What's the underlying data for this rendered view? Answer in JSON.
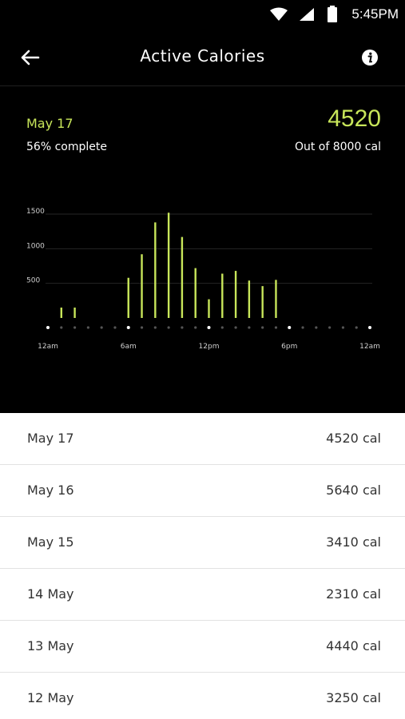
{
  "status_bar": {
    "time": "5:45PM",
    "icons": [
      "wifi-icon",
      "signal-icon",
      "battery-icon"
    ]
  },
  "app_bar": {
    "title": "Active Calories",
    "back_icon": "back-arrow-icon",
    "info_icon": "info-icon"
  },
  "summary": {
    "date": "May 17",
    "percent_text": "56% complete",
    "value": "4520",
    "goal_text": "Out of 8000 cal"
  },
  "colors": {
    "accent": "#c8e65a",
    "background": "#000000",
    "list_background": "#ffffff"
  },
  "chart_data": {
    "type": "bar",
    "x": [
      1,
      2,
      6,
      7,
      8,
      9,
      10,
      11,
      12,
      13,
      14,
      15,
      16,
      17
    ],
    "values": [
      150,
      150,
      580,
      920,
      1380,
      1520,
      1170,
      720,
      270,
      640,
      680,
      540,
      460,
      550
    ],
    "xlim": [
      0,
      24
    ],
    "ylim": [
      0,
      1500
    ],
    "yticks": [
      500,
      1000,
      1500
    ],
    "ytick_labels": [
      "500",
      "1000",
      "1500"
    ],
    "xticks": [
      0,
      6,
      12,
      18,
      24
    ],
    "xtick_labels": [
      "12am",
      "6am",
      "12pm",
      "6pm",
      "12am"
    ],
    "grid": true,
    "bar_color": "#c8e65a"
  },
  "history": [
    {
      "date": "May 17",
      "value": "4520 cal"
    },
    {
      "date": "May 16",
      "value": "5640 cal"
    },
    {
      "date": "May 15",
      "value": "3410 cal"
    },
    {
      "date": "14 May",
      "value": "2310 cal"
    },
    {
      "date": "13 May",
      "value": "4440 cal"
    },
    {
      "date": "12 May",
      "value": "3250 cal"
    }
  ]
}
